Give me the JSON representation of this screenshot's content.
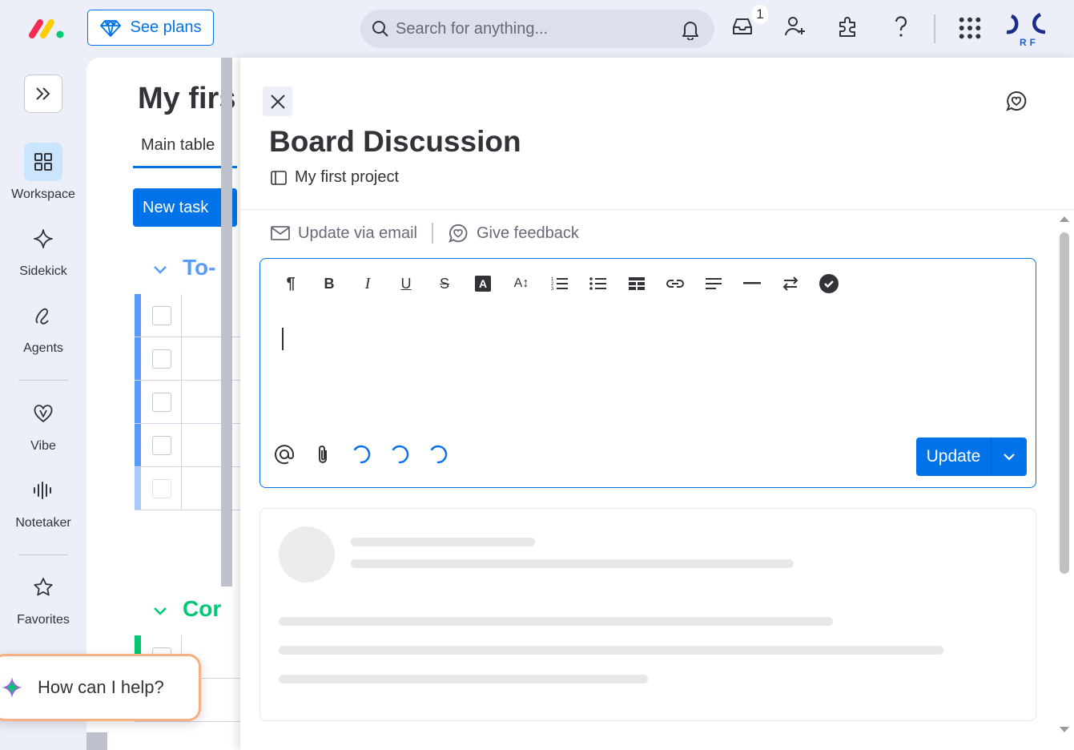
{
  "topbar": {
    "see_plans_label": "See plans",
    "search_placeholder": "Search for anything...",
    "inbox_count": "1",
    "avatar_initials": "RF"
  },
  "sidebar": {
    "items": [
      {
        "label": "Workspace",
        "icon": "grid-icon"
      },
      {
        "label": "Sidekick",
        "icon": "sparkle-icon"
      },
      {
        "label": "Agents",
        "icon": "agent-icon"
      },
      {
        "label": "Vibe",
        "icon": "heart-icon"
      },
      {
        "label": "Notetaker",
        "icon": "waveform-icon"
      },
      {
        "label": "Favorites",
        "icon": "star-icon"
      }
    ]
  },
  "board": {
    "title": "My firs",
    "tab": "Main table",
    "new_task": "New task",
    "groups": [
      {
        "title": "To-",
        "color": "#579bfc"
      },
      {
        "title": "Cor",
        "color": "#00c875"
      }
    ]
  },
  "help": {
    "label": "How can I help?"
  },
  "panel": {
    "title": "Board Discussion",
    "board_link": "My first project",
    "update_via_email": "Update via email",
    "give_feedback": "Give feedback",
    "update_button": "Update"
  },
  "colors": {
    "accent": "#0073ea",
    "background": "#eceff8"
  }
}
